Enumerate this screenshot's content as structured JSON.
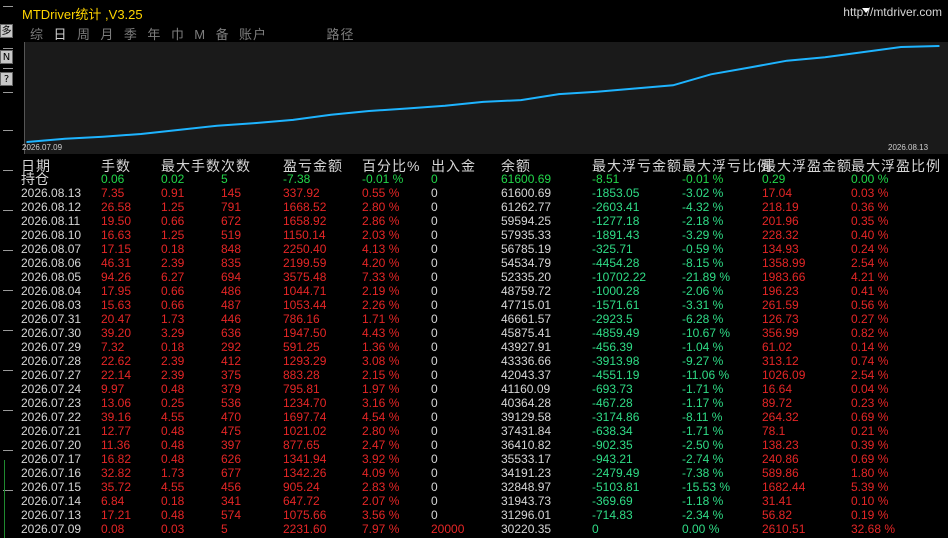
{
  "window": {
    "title": "MTDriver统计 ,V3.25",
    "url": "http://mtdriver.com"
  },
  "left_buttons": [
    "多",
    "N",
    "?"
  ],
  "tabs": [
    {
      "label": "综"
    },
    {
      "label": "日",
      "active": true
    },
    {
      "label": "周"
    },
    {
      "label": "月"
    },
    {
      "label": "季"
    },
    {
      "label": "年"
    },
    {
      "label": "巾"
    },
    {
      "label": "M"
    },
    {
      "label": "备"
    },
    {
      "label": "账户"
    },
    {
      "label": "路径"
    }
  ],
  "colors": {
    "curve": "#1eb4ff",
    "profit": "#e52626",
    "loss": "#2fdc86",
    "hold": "#22d64a",
    "chart_bg": "#1a1a1a"
  },
  "chart_data": {
    "type": "line",
    "x_start": "2026.07.09",
    "x_end": "2026.08.13",
    "x": [
      "2026.07.09",
      "2026.07.13",
      "2026.07.14",
      "2026.07.15",
      "2026.07.16",
      "2026.07.17",
      "2026.07.20",
      "2026.07.21",
      "2026.07.22",
      "2026.07.23",
      "2026.07.24",
      "2026.07.27",
      "2026.07.28",
      "2026.07.29",
      "2026.07.30",
      "2026.07.31",
      "2026.08.03",
      "2026.08.04",
      "2026.08.05",
      "2026.08.06",
      "2026.08.07",
      "2026.08.10",
      "2026.08.11",
      "2026.08.12",
      "2026.08.13"
    ],
    "series": [
      {
        "values": [
          30220.35,
          31296.01,
          31943.73,
          32848.97,
          34191.23,
          35533.17,
          36410.82,
          37431.84,
          39129.58,
          40364.28,
          41160.09,
          42043.37,
          43336.66,
          43927.91,
          45875.41,
          46661.57,
          47715.01,
          48759.72,
          52335.2,
          54534.79,
          56785.19,
          57935.33,
          59594.25,
          61262.77,
          61600.69
        ]
      }
    ]
  },
  "table": {
    "headers": [
      "日期",
      "手数",
      "最大手数",
      "次数",
      "盈亏金额",
      "百分比%",
      "出入金",
      "余额",
      "最大浮亏金额",
      "最大浮亏比例",
      "最大浮盈金额",
      "最大浮盈比例"
    ],
    "hold": [
      "持仓",
      "0.06",
      "0.02",
      "5",
      "-7.38",
      "-0.01 %",
      "0",
      "61600.69",
      "-8.51",
      "-0.01 %",
      "0.29",
      "0.00 %"
    ],
    "rows": [
      [
        "2026.08.13",
        "7.35",
        "0.91",
        "145",
        "337.92",
        "0.55 %",
        "0",
        "61600.69",
        "-1853.05",
        "-3.02 %",
        "17.04",
        "0.03 %"
      ],
      [
        "2026.08.12",
        "26.58",
        "1.25",
        "791",
        "1668.52",
        "2.80 %",
        "0",
        "61262.77",
        "-2603.41",
        "-4.32 %",
        "218.19",
        "0.36 %"
      ],
      [
        "2026.08.11",
        "19.50",
        "0.66",
        "672",
        "1658.92",
        "2.86 %",
        "0",
        "59594.25",
        "-1277.18",
        "-2.18 %",
        "201.96",
        "0.35 %"
      ],
      [
        "2026.08.10",
        "16.63",
        "1.25",
        "519",
        "1150.14",
        "2.03 %",
        "0",
        "57935.33",
        "-1891.43",
        "-3.29 %",
        "228.32",
        "0.40 %"
      ],
      [
        "2026.08.07",
        "17.15",
        "0.18",
        "848",
        "2250.40",
        "4.13 %",
        "0",
        "56785.19",
        "-325.71",
        "-0.59 %",
        "134.93",
        "0.24 %"
      ],
      [
        "2026.08.06",
        "46.31",
        "2.39",
        "835",
        "2199.59",
        "4.20 %",
        "0",
        "54534.79",
        "-4454.28",
        "-8.15 %",
        "1358.99",
        "2.54 %"
      ],
      [
        "2026.08.05",
        "94.26",
        "6.27",
        "694",
        "3575.48",
        "7.33 %",
        "0",
        "52335.20",
        "-10702.22",
        "-21.89 %",
        "1983.66",
        "4.21 %"
      ],
      [
        "2026.08.04",
        "17.95",
        "0.66",
        "486",
        "1044.71",
        "2.19 %",
        "0",
        "48759.72",
        "-1000.28",
        "-2.06 %",
        "196.23",
        "0.41 %"
      ],
      [
        "2026.08.03",
        "15.63",
        "0.66",
        "487",
        "1053.44",
        "2.26 %",
        "0",
        "47715.01",
        "-1571.61",
        "-3.31 %",
        "261.59",
        "0.56 %"
      ],
      [
        "2026.07.31",
        "20.47",
        "1.73",
        "446",
        "786.16",
        "1.71 %",
        "0",
        "46661.57",
        "-2923.5",
        "-6.28 %",
        "126.73",
        "0.27 %"
      ],
      [
        "2026.07.30",
        "39.20",
        "3.29",
        "636",
        "1947.50",
        "4.43 %",
        "0",
        "45875.41",
        "-4859.49",
        "-10.67 %",
        "356.99",
        "0.82 %"
      ],
      [
        "2026.07.29",
        "7.32",
        "0.18",
        "292",
        "591.25",
        "1.36 %",
        "0",
        "43927.91",
        "-456.39",
        "-1.04 %",
        "61.02",
        "0.14 %"
      ],
      [
        "2026.07.28",
        "22.62",
        "2.39",
        "412",
        "1293.29",
        "3.08 %",
        "0",
        "43336.66",
        "-3913.98",
        "-9.27 %",
        "313.12",
        "0.74 %"
      ],
      [
        "2026.07.27",
        "22.14",
        "2.39",
        "375",
        "883.28",
        "2.15 %",
        "0",
        "42043.37",
        "-4551.19",
        "-11.06 %",
        "1026.09",
        "2.54 %"
      ],
      [
        "2026.07.24",
        "9.97",
        "0.48",
        "379",
        "795.81",
        "1.97 %",
        "0",
        "41160.09",
        "-693.73",
        "-1.71 %",
        "16.64",
        "0.04 %"
      ],
      [
        "2026.07.23",
        "13.06",
        "0.25",
        "536",
        "1234.70",
        "3.16 %",
        "0",
        "40364.28",
        "-467.28",
        "-1.17 %",
        "89.72",
        "0.23 %"
      ],
      [
        "2026.07.22",
        "39.16",
        "4.55",
        "470",
        "1697.74",
        "4.54 %",
        "0",
        "39129.58",
        "-3174.86",
        "-8.11 %",
        "264.32",
        "0.69 %"
      ],
      [
        "2026.07.21",
        "12.77",
        "0.48",
        "475",
        "1021.02",
        "2.80 %",
        "0",
        "37431.84",
        "-638.34",
        "-1.71 %",
        "78.1",
        "0.21 %"
      ],
      [
        "2026.07.20",
        "11.36",
        "0.48",
        "397",
        "877.65",
        "2.47 %",
        "0",
        "36410.82",
        "-902.35",
        "-2.50 %",
        "138.23",
        "0.39 %"
      ],
      [
        "2026.07.17",
        "16.82",
        "0.48",
        "626",
        "1341.94",
        "3.92 %",
        "0",
        "35533.17",
        "-943.21",
        "-2.74 %",
        "240.86",
        "0.69 %"
      ],
      [
        "2026.07.16",
        "32.82",
        "1.73",
        "677",
        "1342.26",
        "4.09 %",
        "0",
        "34191.23",
        "-2479.49",
        "-7.38 %",
        "589.86",
        "1.80 %"
      ],
      [
        "2026.07.15",
        "35.72",
        "4.55",
        "456",
        "905.24",
        "2.83 %",
        "0",
        "32848.97",
        "-5103.81",
        "-15.53 %",
        "1682.44",
        "5.39 %"
      ],
      [
        "2026.07.14",
        "6.84",
        "0.18",
        "341",
        "647.72",
        "2.07 %",
        "0",
        "31943.73",
        "-369.69",
        "-1.18 %",
        "31.41",
        "0.10 %"
      ],
      [
        "2026.07.13",
        "17.21",
        "0.48",
        "574",
        "1075.66",
        "3.56 %",
        "0",
        "31296.01",
        "-714.83",
        "-2.34 %",
        "56.82",
        "0.19 %"
      ],
      [
        "2026.07.09",
        "0.08",
        "0.03",
        "5",
        "2231.60",
        "7.97 %",
        "20000",
        "30220.35",
        "0",
        "0.00 %",
        "2610.51",
        "32.68 %"
      ]
    ]
  }
}
